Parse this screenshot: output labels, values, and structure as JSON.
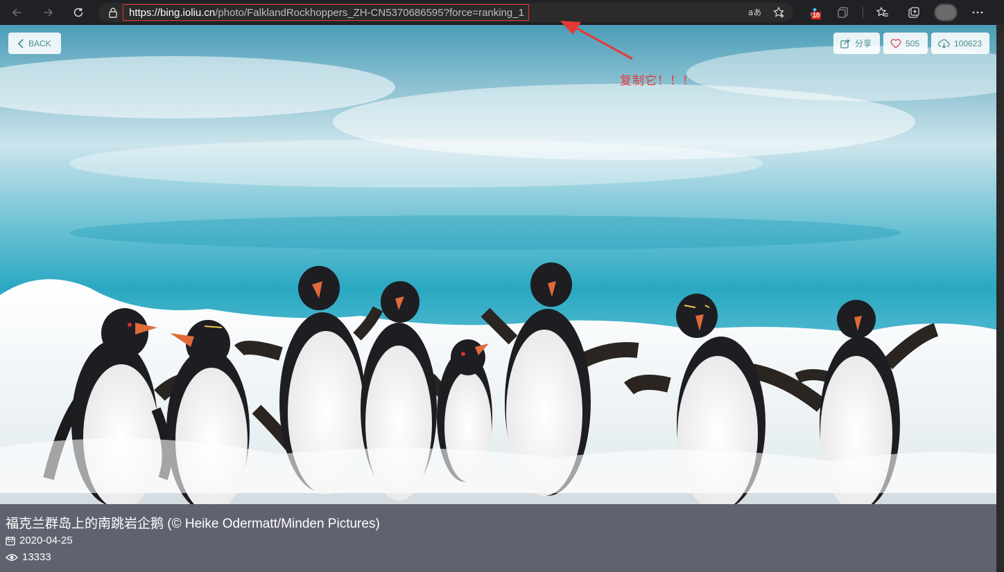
{
  "browser": {
    "url_host": "https://bing.ioliu.cn",
    "url_path": "/photo/FalklandRockhoppers_ZH-CN5370686595?force=ranking_1",
    "extensions_badge": "10",
    "icons": [
      "back-arrow-icon",
      "forward-arrow-icon",
      "refresh-icon",
      "lock-icon",
      "read-aloud-icon",
      "add-favorite-icon",
      "extension-icon",
      "collections-icon",
      "favorites-icon",
      "tab-actions-icon",
      "more-icon"
    ]
  },
  "photo": {
    "back_label": "BACK",
    "share_label": "分享",
    "likes": "505",
    "downloads": "100623"
  },
  "annotation": {
    "text": "复制它！！！",
    "color": "#e53935"
  },
  "caption": {
    "title": "福克兰群岛上的南跳岩企鹅 (© Heike Odermatt/Minden Pictures)",
    "date": "2020-04-25",
    "views": "13333"
  },
  "colors": {
    "accent": "#4a8d8a",
    "like_heart": "#e5484d",
    "caption_bg": "#606270"
  }
}
